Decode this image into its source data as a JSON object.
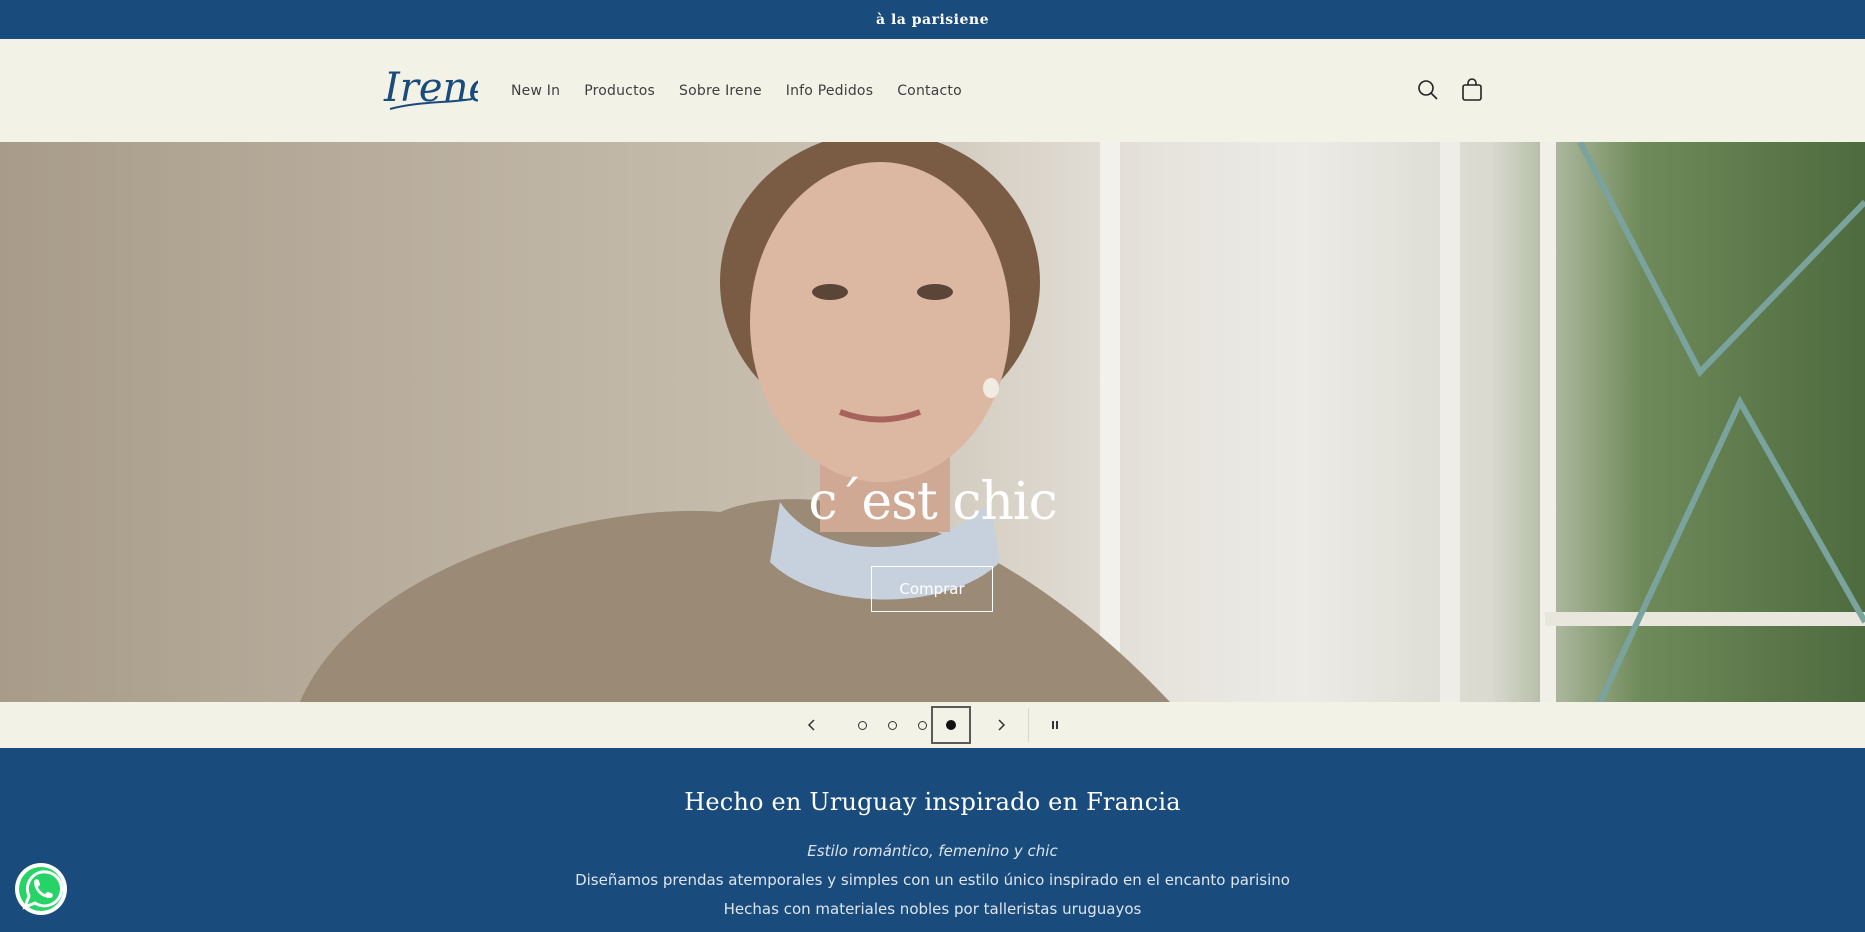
{
  "announcement": {
    "text": "à la parisiene"
  },
  "header": {
    "logo_text": "Irene",
    "nav": [
      "New In",
      "Productos",
      "Sobre Irene",
      "Info Pedidos",
      "Contacto"
    ],
    "icons": {
      "search": "search-icon",
      "cart": "cart-icon"
    }
  },
  "hero": {
    "title": "c´est chic",
    "button_label": "Comprar"
  },
  "slideshow": {
    "slides_total": 4,
    "active_slide": 4,
    "icons": {
      "prev": "chevron-left-icon",
      "next": "chevron-right-icon",
      "pause": "pause-icon"
    }
  },
  "about": {
    "title": "Hecho en Uruguay inspirado en Francia",
    "tagline": "Estilo romántico, femenino y chic",
    "line1": "Diseñamos prendas atemporales y simples con un estilo único inspirado en el encanto parisino",
    "line2": "Hechas con materiales nobles por talleristas uruguayos"
  },
  "colors": {
    "brand_blue": "#1a4b7d",
    "cream": "#f3f2e6"
  }
}
